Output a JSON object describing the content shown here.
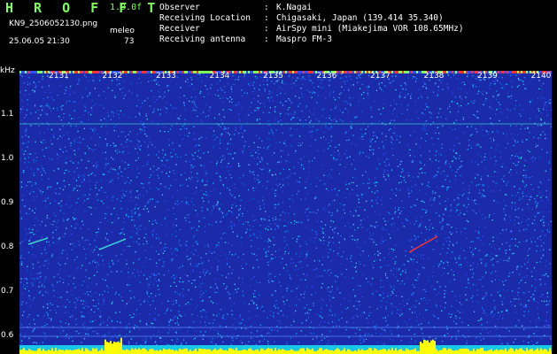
{
  "header": {
    "app_title": "H R O F F T",
    "version": "1.0.0f",
    "filename": "KN9_2506052130.png",
    "datetime": "25.06.05 21:30",
    "site": "meleo",
    "count": "73",
    "info": [
      {
        "key": "Observer",
        "value": "K.Nagai"
      },
      {
        "key": "Receiving Location",
        "value": "Chigasaki, Japan (139.414 35.340)"
      },
      {
        "key": "Receiver",
        "value": "AirSpy mini (Miakejima VOR 108.65MHz)"
      },
      {
        "key": "Receiving antenna",
        "value": "Maspro FM-3"
      }
    ]
  },
  "spectrogram": {
    "unit": "kHz",
    "y_ticks": [
      "1.1",
      "1.0",
      "0.9",
      "0.8",
      "0.7",
      "0.6"
    ],
    "x_ticks": [
      "2131",
      "2132",
      "2133",
      "2134",
      "2135",
      "2136",
      "2137",
      "2138",
      "2139",
      "2140"
    ],
    "colors": {
      "background": "#1a2aa8",
      "noise": "#2aa8ff",
      "signal": "#ffff00",
      "echo": "#ff3030"
    }
  }
}
